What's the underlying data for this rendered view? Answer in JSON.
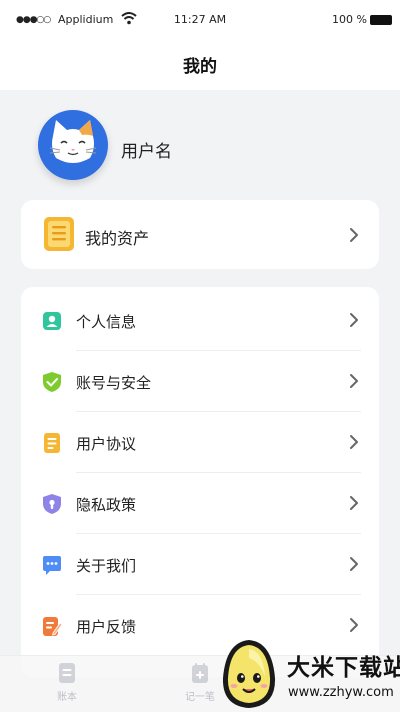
{
  "status_bar": {
    "signal": "●●●○○",
    "carrier": "Applidium",
    "time": "11:27 AM",
    "battery_percent": "100 %"
  },
  "header": {
    "title": "我的"
  },
  "profile": {
    "username": "用户名",
    "avatar_icon": "cat-avatar-icon",
    "avatar_color": "#2f6fe0"
  },
  "assets": {
    "label": "我的资产",
    "icon": "assets-icon",
    "icon_color": "#f5b631"
  },
  "menu": {
    "items": [
      {
        "label": "个人信息",
        "icon": "person-card-icon",
        "color": "#2fc59d"
      },
      {
        "label": "账号与安全",
        "icon": "shield-check-icon",
        "color": "#7ecb2f"
      },
      {
        "label": "用户协议",
        "icon": "document-icon",
        "color": "#f5b631"
      },
      {
        "label": "隐私政策",
        "icon": "privacy-shield-icon",
        "color": "#8e84e8"
      },
      {
        "label": "关于我们",
        "icon": "chat-bubble-icon",
        "color": "#4e8df5"
      },
      {
        "label": "用户反馈",
        "icon": "feedback-edit-icon",
        "color": "#f07a3a"
      }
    ]
  },
  "tabbar": {
    "tabs": [
      {
        "label": "账本",
        "icon": "ledger-icon"
      },
      {
        "label": "记一笔",
        "icon": "calendar-add-icon"
      }
    ]
  },
  "watermark": {
    "title": "大米下载站",
    "url": "www.zzhyw.com"
  }
}
